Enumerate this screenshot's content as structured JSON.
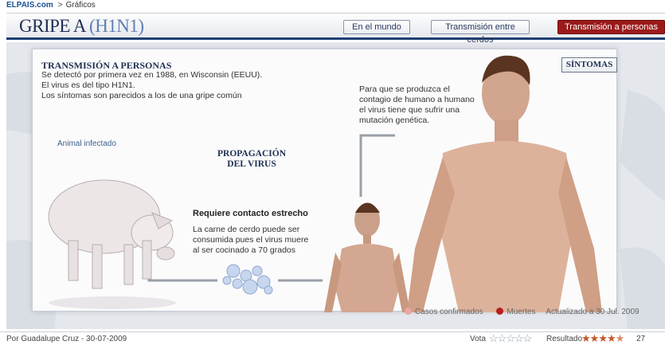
{
  "topbar": {
    "brand": "ELPAIS.com",
    "separator": ">",
    "section": "Gráficos"
  },
  "header": {
    "title_main": "GRIPE A",
    "title_sub": "(H1N1)",
    "nav": [
      {
        "label": "En el mundo",
        "active": false
      },
      {
        "label": "Transmisión entre cerdos",
        "active": false
      },
      {
        "label": "Transmisión a personas",
        "active": true
      }
    ]
  },
  "panel": {
    "title": "TRANSMISIÓN A PERSONAS",
    "intro": [
      "Se detectó por primera vez en 1988, en Wisconsin (EEUU).",
      "El virus es del tipo H1N1.",
      "Los síntomas son parecidos a los de una gripe común"
    ],
    "sintomas_label": "SÍNTOMAS",
    "mutacion_text": "Para que se produzca el contagio de humano a humano el virus tiene que sufrir una mutación genética.",
    "animal_label": "Animal infectado",
    "propagacion_label": "PROPAGACIÓN DEL VIRUS",
    "contacto_title": "Requiere contacto estrecho",
    "contacto_text": "La carne de cerdo puede ser consumida pues el virus muere al ser cocinado a 70 grados"
  },
  "legend": {
    "casos": "Casos confirmados",
    "muertes": "Muertes",
    "actualizado": "Actualizado a 30 Jul. 2009",
    "colors": {
      "casos": "#e8a6a6",
      "muertes": "#b81e1e"
    }
  },
  "footer": {
    "author": "Por Guadalupe Cruz - 30-07-2009",
    "vote_label": "Vota",
    "result_label": "Resultado",
    "rating": 4.5,
    "votes": "27 votos"
  },
  "colors": {
    "accent": "#9b1a1a",
    "navy": "#1e2f52",
    "header_rule": "#1f3f73"
  }
}
